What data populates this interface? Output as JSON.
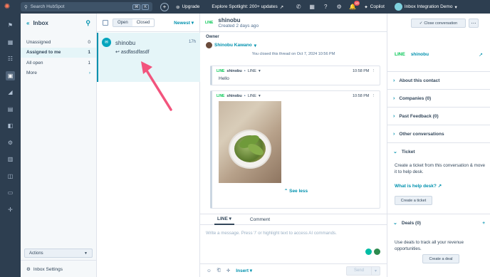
{
  "topbar": {
    "search_placeholder": "Search HubSpot",
    "kbd1": "⌘",
    "kbd2": "K",
    "upgrade": "Upgrade",
    "spotlight": "Explore Spotlight: 200+ updates",
    "notif_count": "10",
    "copilot": "Copilot",
    "account": "Inbox Integration Demo"
  },
  "inbox": {
    "title": "Inbox",
    "folders": [
      {
        "label": "Unassigned",
        "count": "0"
      },
      {
        "label": "Assigned to me",
        "count": "1"
      },
      {
        "label": "All open",
        "count": "1"
      },
      {
        "label": "More",
        "count": ""
      }
    ],
    "actions": "Actions",
    "settings": "Inbox Settings"
  },
  "list": {
    "open": "Open",
    "closed": "Closed",
    "sort": "Newest",
    "item": {
      "name": "shinobu",
      "time": "17h",
      "preview": "asdfasdfasdf"
    }
  },
  "thread": {
    "channel": "LINE",
    "name": "shinobu",
    "created": "Created 2 days ago",
    "owner_label": "Owner",
    "owner": "Shinobu Kawano",
    "system": "You closed this thread on Oct 7, 2024 10:56 PM",
    "msg1": {
      "sender": "shinobu",
      "channel": "LINE",
      "time": "10:58 PM",
      "text": "Hello"
    },
    "msg2": {
      "sender": "shinobu",
      "channel": "LINE",
      "time": "10:58 PM"
    },
    "see_less": "See less",
    "tab_line": "LINE",
    "tab_comment": "Comment",
    "placeholder": "Write a message. Press '/' or highlight text to access AI commands.",
    "insert": "Insert",
    "send": "Send"
  },
  "right": {
    "close": "Close conversation",
    "contact_channel": "LINE",
    "contact_name": "shinobu",
    "sections": [
      "About this contact",
      "Companies (0)",
      "Past Feedback (0)",
      "Other conversations"
    ],
    "ticket": "Ticket",
    "ticket_text": "Create a ticket from this conversation & move it to help desk.",
    "help_link": "What is help desk?",
    "create_ticket": "Create a ticket",
    "deals": "Deals (0)",
    "deals_text": "Use deals to track all your revenue opportunities.",
    "create_deal": "Create a deal"
  },
  "colors": {
    "nav": "#2d3e50",
    "accent": "#0091ae",
    "line": "#06c755",
    "selected": "#e5f5f8",
    "arrow": "#f2547d"
  }
}
